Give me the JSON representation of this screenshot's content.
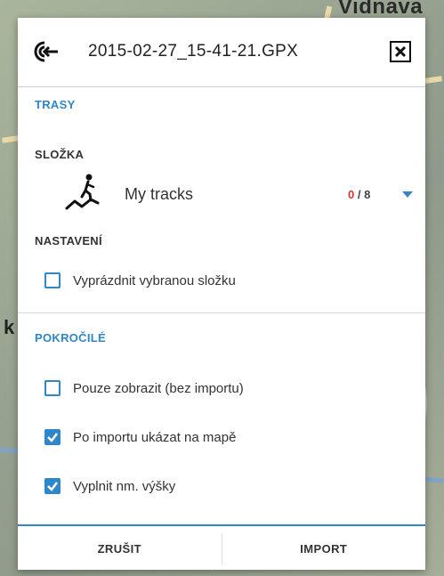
{
  "background": {
    "map_label": "Vidnava",
    "map_letter": "k"
  },
  "dialog": {
    "title": "2015-02-27_15-41-21.GPX",
    "header_icon": "import-icon",
    "close_icon": "close-icon"
  },
  "sections": {
    "tracks_label": "TRASY",
    "folder_label": "SLOŽKA",
    "settings_label": "NASTAVENÍ",
    "advanced_label": "POKROČILÉ"
  },
  "folder": {
    "icon": "hiker-track-icon",
    "name": "My tracks",
    "count_selected": "0",
    "count_separator": " / ",
    "count_total": "8",
    "dropdown_icon": "dropdown-arrow-icon"
  },
  "options": {
    "empty_folder": {
      "label": "Vyprázdnit vybranou složku",
      "checked": false
    },
    "only_show": {
      "label": "Pouze zobrazit (bez importu)",
      "checked": false
    },
    "show_on_map": {
      "label": "Po importu ukázat na mapě",
      "checked": true
    },
    "fill_elevation": {
      "label": "Vyplnit nm. výšky",
      "checked": true
    }
  },
  "footer": {
    "cancel_label": "ZRUŠIT",
    "import_label": "IMPORT"
  },
  "colors": {
    "accent": "#2f86c9",
    "count_red": "#d23a2f"
  }
}
